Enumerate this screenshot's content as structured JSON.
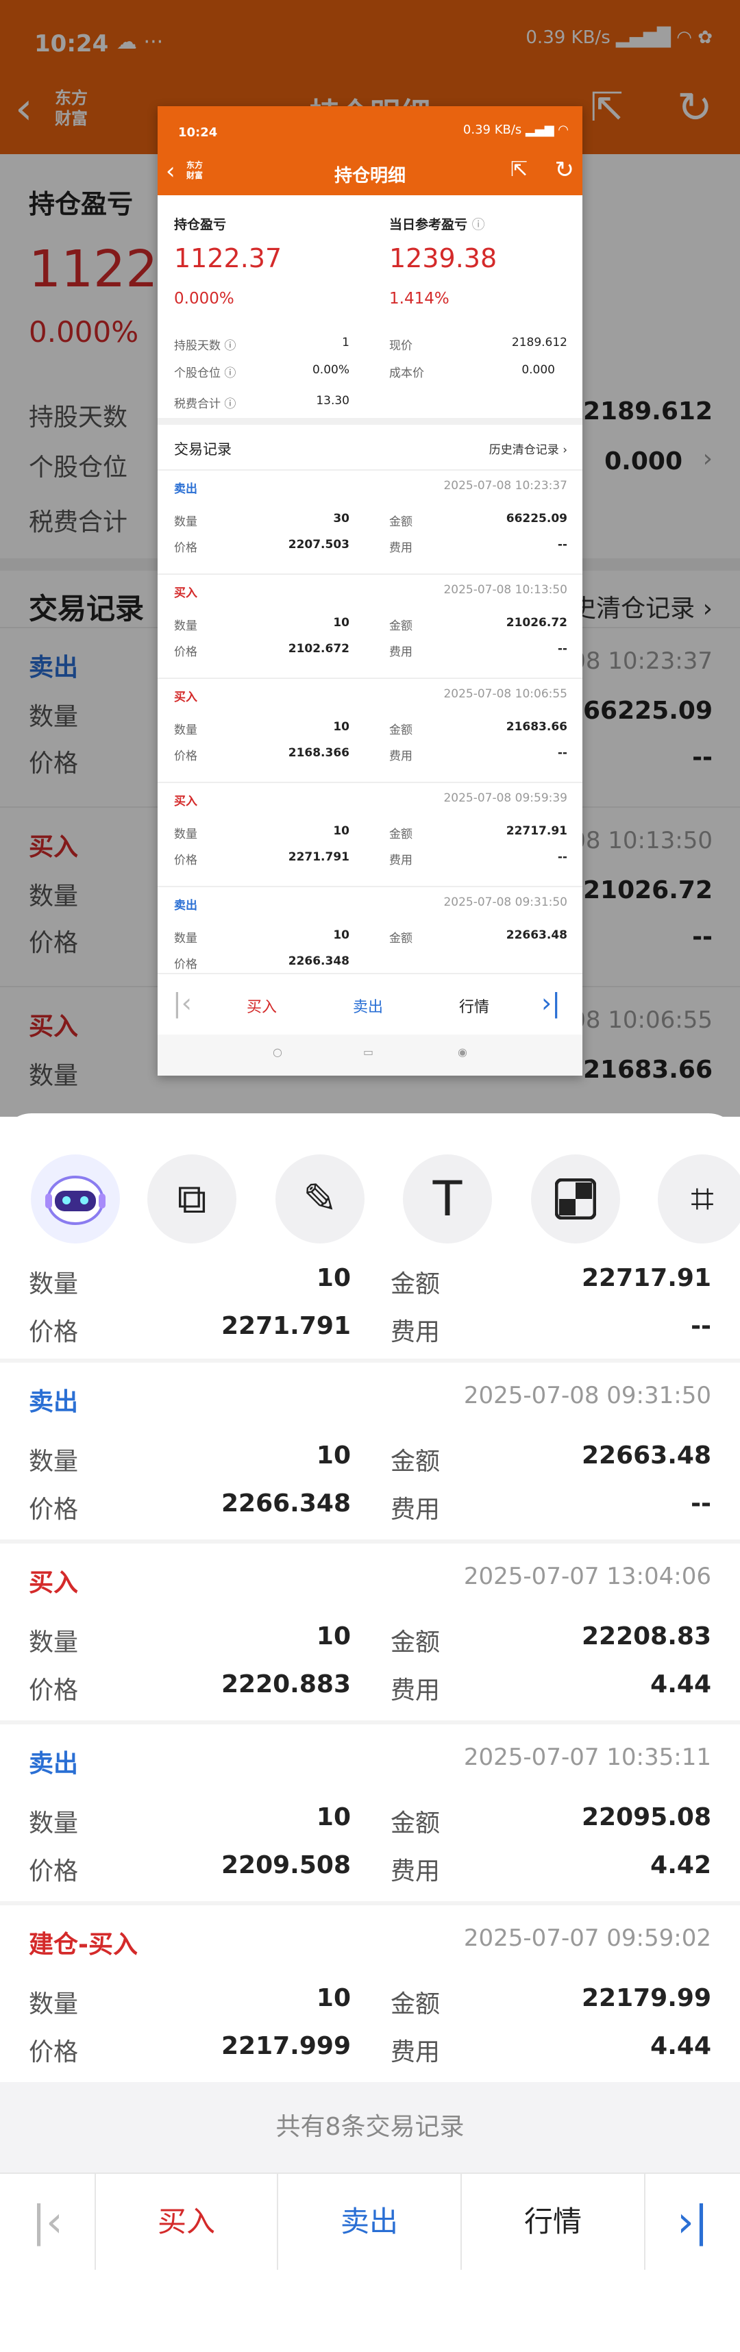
{
  "status": {
    "time": "10:24",
    "network": "0.39 KB/s",
    "icons": "☁ ···"
  },
  "nav": {
    "logo": "东方财富",
    "title": "持仓明细"
  },
  "summary": {
    "pnl_label": "持仓盈亏",
    "pnl_value": "1122.37",
    "pnl_pct": "0.000%",
    "ref_label": "当日参考盈亏",
    "ref_value": "1239.38",
    "ref_pct": "1.414%",
    "hold_days_label": "持股天数",
    "hold_days_value": "1",
    "position_label": "个股仓位",
    "position_value": "0.00%",
    "tax_label": "税费合计",
    "tax_value": "13.30",
    "price_label": "现价",
    "price_value": "2189.612",
    "cost_label": "成本价",
    "cost_value": "0.000"
  },
  "trades_header": {
    "title": "交易记录",
    "history_link": "历史清仓记录"
  },
  "labels": {
    "qty": "数量",
    "price": "价格",
    "amount": "金额",
    "fee": "费用"
  },
  "bg_trades": [
    {
      "type": "卖出",
      "date": "08 10:23:37",
      "amount": "66225.09",
      "fee": "--"
    },
    {
      "type": "买入",
      "date": "08 10:13:50",
      "amount": "21026.72",
      "fee": "--"
    },
    {
      "type": "买入",
      "date": "08 10:06:55",
      "amount": "21683.66",
      "fee": "--"
    }
  ],
  "thumb_trades": [
    {
      "type": "卖出",
      "date": "2025-07-08 10:23:37",
      "qty": "30",
      "amount": "66225.09",
      "price": "2207.503",
      "fee": "--"
    },
    {
      "type": "买入",
      "date": "2025-07-08 10:13:50",
      "qty": "10",
      "amount": "21026.72",
      "price": "2102.672",
      "fee": "--"
    },
    {
      "type": "买入",
      "date": "2025-07-08 10:06:55",
      "qty": "10",
      "amount": "21683.66",
      "price": "2168.366",
      "fee": "--"
    },
    {
      "type": "买入",
      "date": "2025-07-08 09:59:39",
      "qty": "10",
      "amount": "22717.91",
      "price": "2271.791",
      "fee": "--"
    },
    {
      "type": "卖出",
      "date": "2025-07-08 09:31:50",
      "qty": "10",
      "amount": "22663.48",
      "price": "2266.348",
      "fee": "--"
    }
  ],
  "sheet_first": {
    "qty": "10",
    "amount": "22717.91",
    "price": "2271.791",
    "fee": "--"
  },
  "sheet_trades": [
    {
      "type": "卖出",
      "date": "2025-07-08 09:31:50",
      "qty": "10",
      "amount": "22663.48",
      "price": "2266.348",
      "fee": "--"
    },
    {
      "type": "买入",
      "date": "2025-07-07 13:04:06",
      "qty": "10",
      "amount": "22208.83",
      "price": "2220.883",
      "fee": "4.44"
    },
    {
      "type": "卖出",
      "date": "2025-07-07 10:35:11",
      "qty": "10",
      "amount": "22095.08",
      "price": "2209.508",
      "fee": "4.42"
    },
    {
      "type": "建仓-买入",
      "date": "2025-07-07 09:59:02",
      "qty": "10",
      "amount": "22179.99",
      "price": "2217.999",
      "fee": "4.44"
    }
  ],
  "footer": {
    "count_text": "共有8条交易记录"
  },
  "actions": {
    "buy": "买入",
    "sell": "卖出",
    "market": "行情"
  },
  "tools": [
    "robot-assistant-icon",
    "screenshot-capture-icon",
    "pencil-icon",
    "text-icon",
    "mosaic-icon",
    "crop-icon"
  ],
  "colors": {
    "brand_orange": "#e8630f",
    "buy_red": "#d42a2a",
    "sell_blue": "#2a6fd4"
  }
}
